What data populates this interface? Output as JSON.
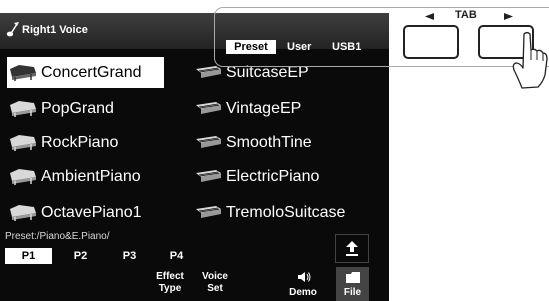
{
  "screen": {
    "title": "Right1 Voice",
    "tabs": [
      "Preset",
      "User",
      "USB1"
    ],
    "selected_tab": "Preset",
    "voices_left": [
      "ConcertGrand",
      "PopGrand",
      "RockPiano",
      "AmbientPiano",
      "OctavePiano1"
    ],
    "voices_right": [
      "SuitcaseEP",
      "VintageEP",
      "SmoothTine",
      "ElectricPiano",
      "TremoloSuitcase"
    ],
    "selected_voice": "ConcertGrand",
    "path": "Preset:/Piano&E.Piano/",
    "pages": [
      "P1",
      "P2",
      "P3",
      "P4"
    ],
    "selected_page": "P1",
    "functions": {
      "effect_line1": "Effect",
      "effect_line2": "Type",
      "voice_line1": "Voice",
      "voice_line2": "Set",
      "demo": "Demo",
      "file": "File"
    },
    "icons": {
      "title": "note-icon",
      "left_column": "grand-piano-icon",
      "right_column": "keyboard-icon",
      "up": "up-arrow-icon",
      "demo": "speaker-icon",
      "file": "folder-icon"
    }
  },
  "panel": {
    "tab_label": "TAB",
    "left_arrow": "◀",
    "right_arrow": "▶",
    "pressed_button": "right"
  }
}
